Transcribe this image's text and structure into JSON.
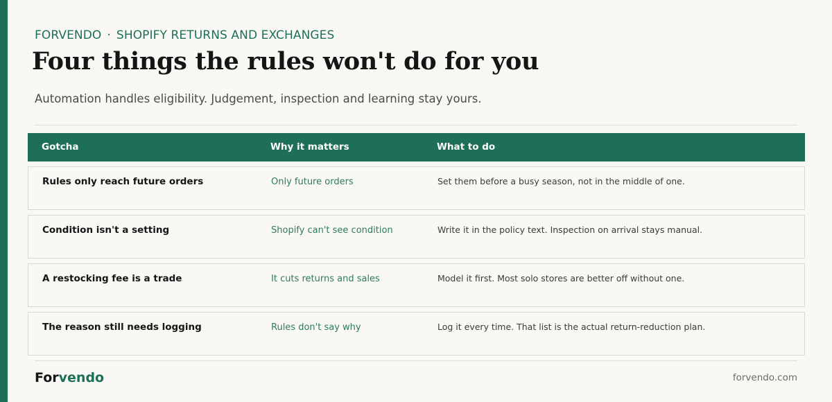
{
  "header": {
    "brand": "FORVENDO",
    "separator": "·",
    "section": "SHOPIFY RETURNS AND EXCHANGES",
    "title": "Four things the rules won't do for you",
    "subtitle": "Automation handles eligibility. Judgement, inspection and learning stay yours."
  },
  "table": {
    "columns": [
      "Gotcha",
      "Why it matters",
      "What to do"
    ],
    "rows": [
      {
        "gotcha": "Rules only reach future orders",
        "why": "Only future orders",
        "todo": "Set them before a busy season, not in the middle of one."
      },
      {
        "gotcha": "Condition isn't a setting",
        "why": "Shopify can't see condition",
        "todo": "Write it in the policy text. Inspection on arrival stays manual."
      },
      {
        "gotcha": "A restocking fee is a trade",
        "why": "It cuts returns and sales",
        "todo": "Model it first. Most solo stores are better off without one."
      },
      {
        "gotcha": "The reason still needs logging",
        "why": "Rules don't say why",
        "todo": "Log it every time. That list is the actual return-reduction plan."
      }
    ]
  },
  "footer": {
    "logo_part1": "For",
    "logo_part2": "vendo",
    "site": "forvendo.com"
  },
  "colors": {
    "accent": "#1e6f58",
    "background": "#f9f8f4"
  }
}
